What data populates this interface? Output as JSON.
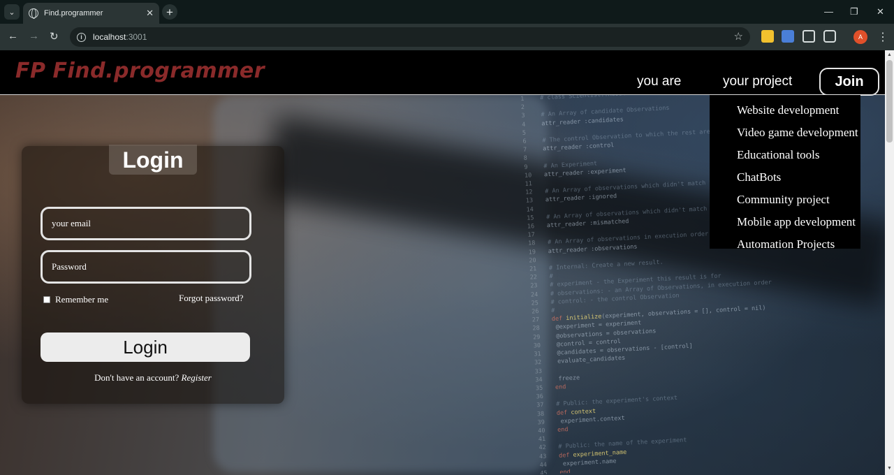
{
  "browser": {
    "tab_title": "Find.programmer",
    "url_host": "localhost",
    "url_port": ":3001",
    "avatar_letter": "A"
  },
  "site": {
    "logo_mark": "FP",
    "logo_text": "Find.programmer",
    "nav": {
      "you_are": "you are",
      "your_project": "your project",
      "join": "Join"
    },
    "dropdown": [
      "Website development",
      "Video game development",
      "Educational tools",
      "ChatBots",
      "Community project",
      "Mobile app development",
      "Automation Projects"
    ]
  },
  "login": {
    "title": "Login",
    "email_placeholder": "your email",
    "password_placeholder": "Password",
    "remember": "Remember me",
    "forgot": "Forgot password?",
    "button": "Login",
    "no_account": "Don't have an account?",
    "register": "Register"
  },
  "colors": {
    "logo": "#8a2a2a",
    "header_bg": "#000000",
    "button_bg": "#ececec"
  }
}
